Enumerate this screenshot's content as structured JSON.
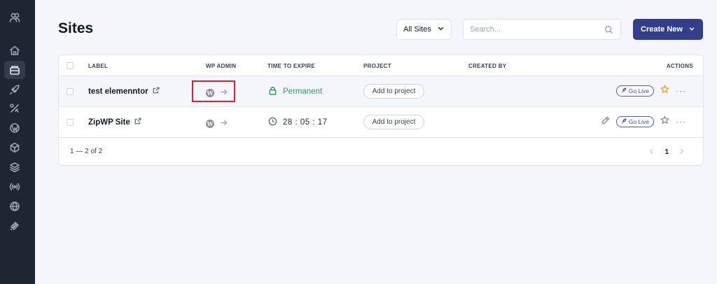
{
  "page": {
    "title": "Sites"
  },
  "toolbar": {
    "filter_label": "All Sites",
    "search_placeholder": "Search...",
    "create_label": "Create New"
  },
  "sidebar": {
    "icons": [
      "users-icon",
      "home-icon",
      "sites-icon",
      "rocket-icon",
      "tools-icon",
      "wordpress-icon",
      "box-icon",
      "layers-icon",
      "broadcast-icon",
      "globe-icon",
      "brand-icon"
    ],
    "active": "sites-icon"
  },
  "table": {
    "columns": {
      "label": "LABEL",
      "wp_admin": "WP ADMIN",
      "time_to_expire": "TIME TO EXPIRE",
      "project": "PROJECT",
      "created_by": "CREATED BY",
      "actions": "ACTIONS"
    },
    "rows": [
      {
        "label": "test elemenntor",
        "expire": "Permanent",
        "expire_type": "permanent",
        "project_button": "Add to project",
        "go_live": "Go Live",
        "starred": true
      },
      {
        "label": "ZipWP Site",
        "expire": "28 : 05 : 17",
        "expire_type": "timer",
        "project_button": "Add to project",
        "go_live": "Go Live",
        "starred": false
      }
    ],
    "pagination": {
      "summary": "1 — 2 of 2",
      "current_page": "1"
    }
  },
  "colors": {
    "sidebar_bg": "#1e2633",
    "primary": "#323e8c",
    "permanent_green": "#2e9e4f",
    "highlight_red": "#e01e27",
    "star_gold": "#e8a82a"
  }
}
